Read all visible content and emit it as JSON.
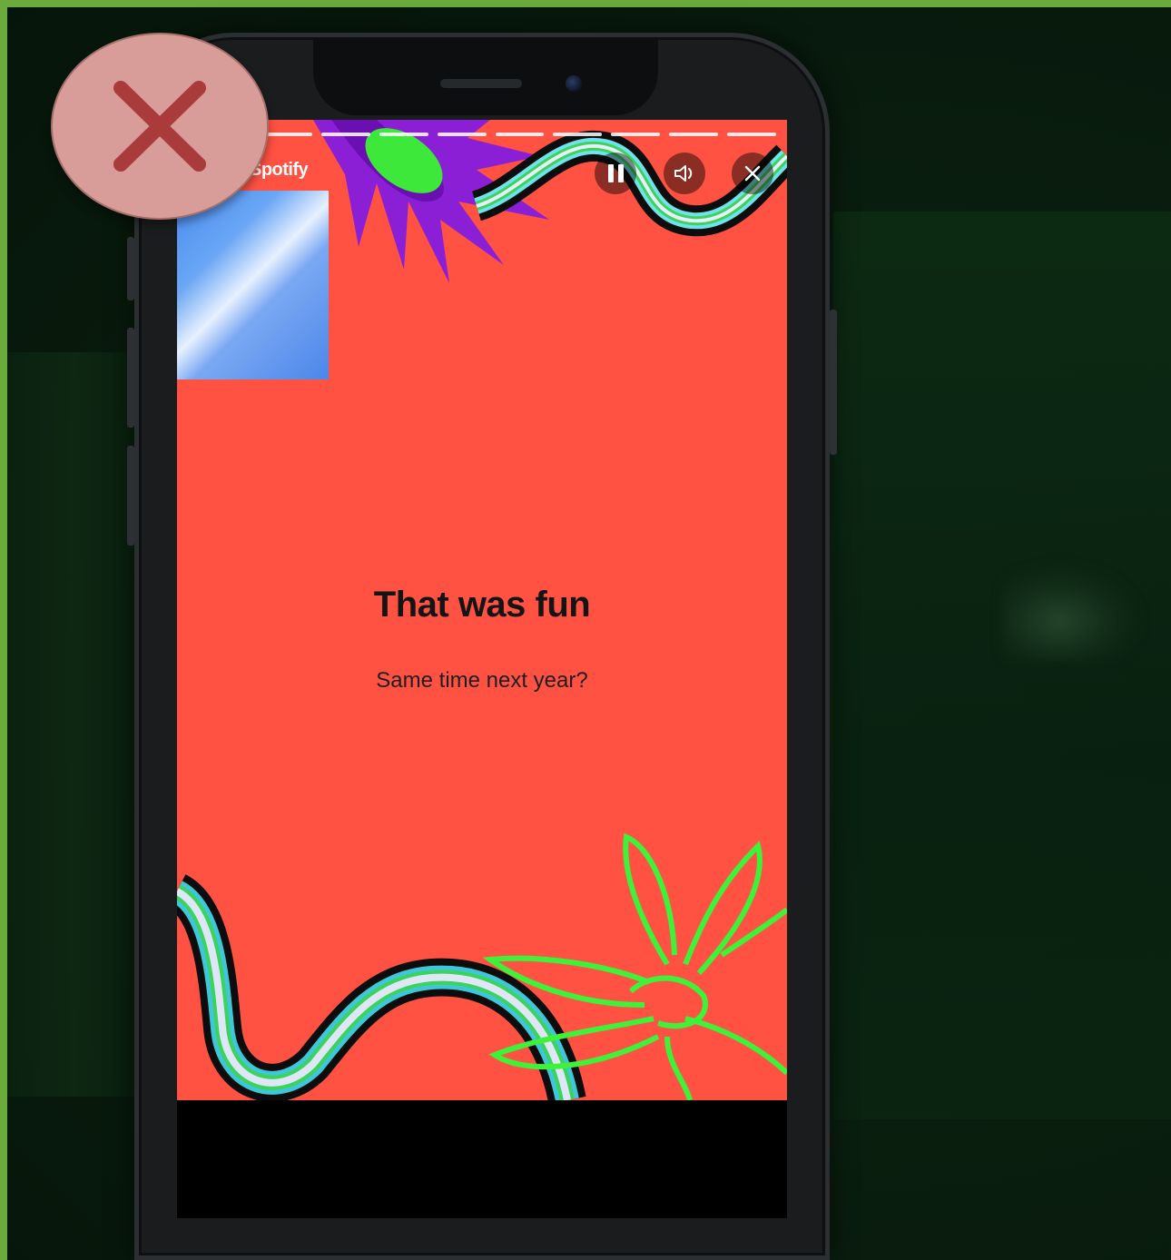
{
  "story": {
    "brand_label": "Spotify",
    "headline": "That was fun",
    "subheadline": "Same time next year?",
    "progress_segments": 9,
    "background_color": "#ff5242"
  },
  "controls": {
    "pause_icon": "pause-icon",
    "volume_icon": "volume-icon",
    "close_icon": "close-icon"
  },
  "overlay": {
    "reject_icon": "red-x-icon",
    "reject_color": "#a93b3a"
  }
}
